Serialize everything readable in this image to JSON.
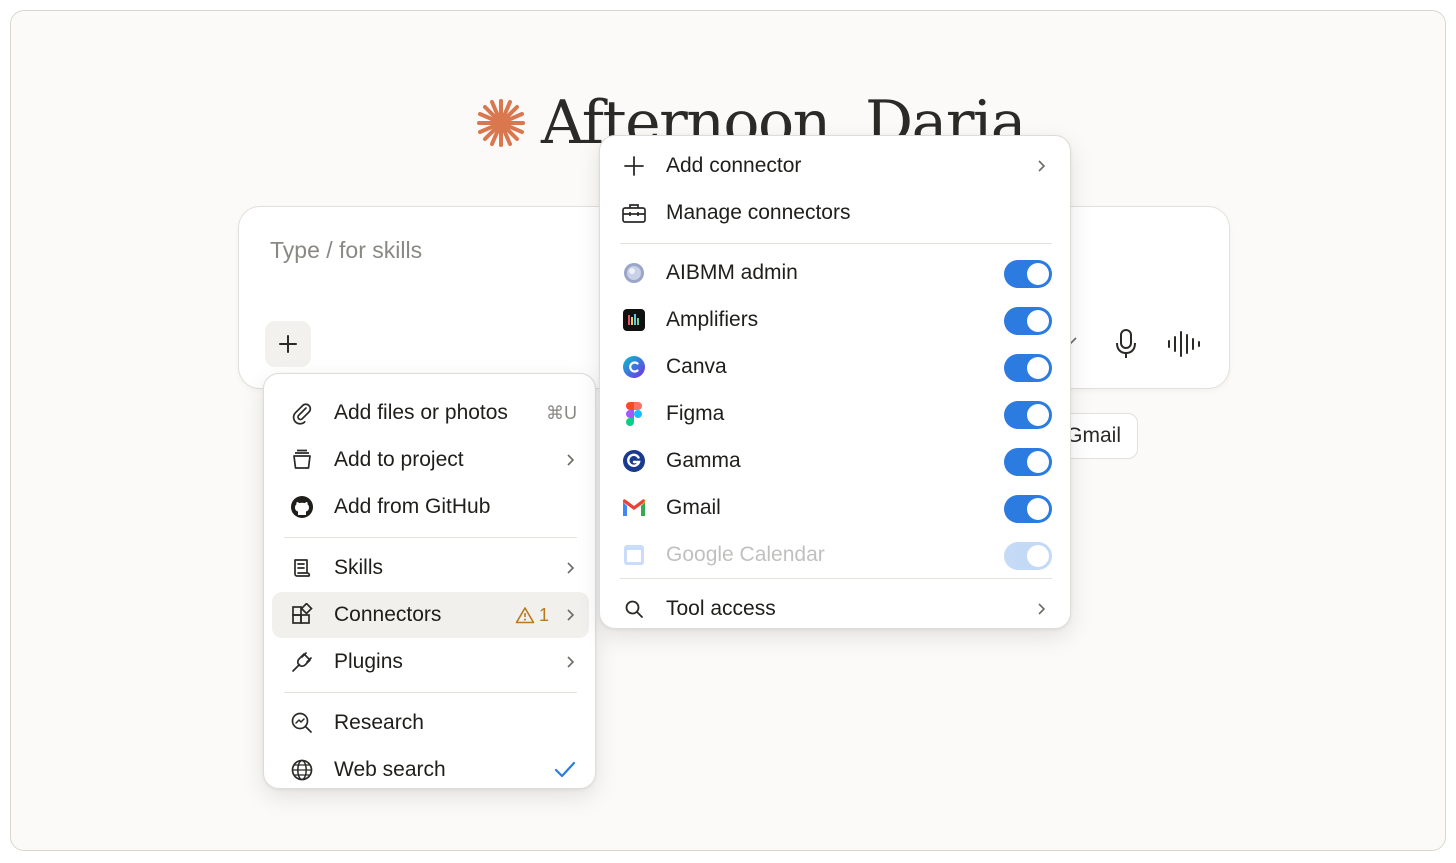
{
  "greeting": {
    "text": "Afternoon, Daria"
  },
  "composer": {
    "placeholder": "Type / for skills",
    "chip_label": "Gmail"
  },
  "plus_menu": {
    "items": [
      {
        "label": "Add files or photos",
        "shortcut": "⌘U",
        "icon": "paperclip-icon"
      },
      {
        "label": "Add to project",
        "icon": "project-box-icon",
        "submenu": true
      },
      {
        "label": "Add from GitHub",
        "icon": "github-icon"
      },
      {
        "label": "Skills",
        "icon": "scroll-icon",
        "submenu": true
      },
      {
        "label": "Connectors",
        "icon": "grid-plus-icon",
        "submenu": true,
        "warning_count": "1",
        "active": true
      },
      {
        "label": "Plugins",
        "icon": "plug-icon",
        "submenu": true
      },
      {
        "label": "Research",
        "icon": "research-icon"
      },
      {
        "label": "Web search",
        "icon": "globe-icon",
        "checked": true
      }
    ]
  },
  "connectors_menu": {
    "add_connector": "Add connector",
    "manage_connectors": "Manage connectors",
    "connectors": [
      {
        "label": "AIBMM admin",
        "enabled": true
      },
      {
        "label": "Amplifiers",
        "enabled": true
      },
      {
        "label": "Canva",
        "enabled": true
      },
      {
        "label": "Figma",
        "enabled": true
      },
      {
        "label": "Gamma",
        "enabled": true
      },
      {
        "label": "Gmail",
        "enabled": true
      },
      {
        "label": "Google Calendar",
        "enabled": true
      }
    ],
    "tool_access": "Tool access"
  },
  "colors": {
    "accent_orange": "#d9774f",
    "toggle_blue": "#2b7be0",
    "warning": "#b7791f",
    "check_blue": "#2b7be0"
  }
}
